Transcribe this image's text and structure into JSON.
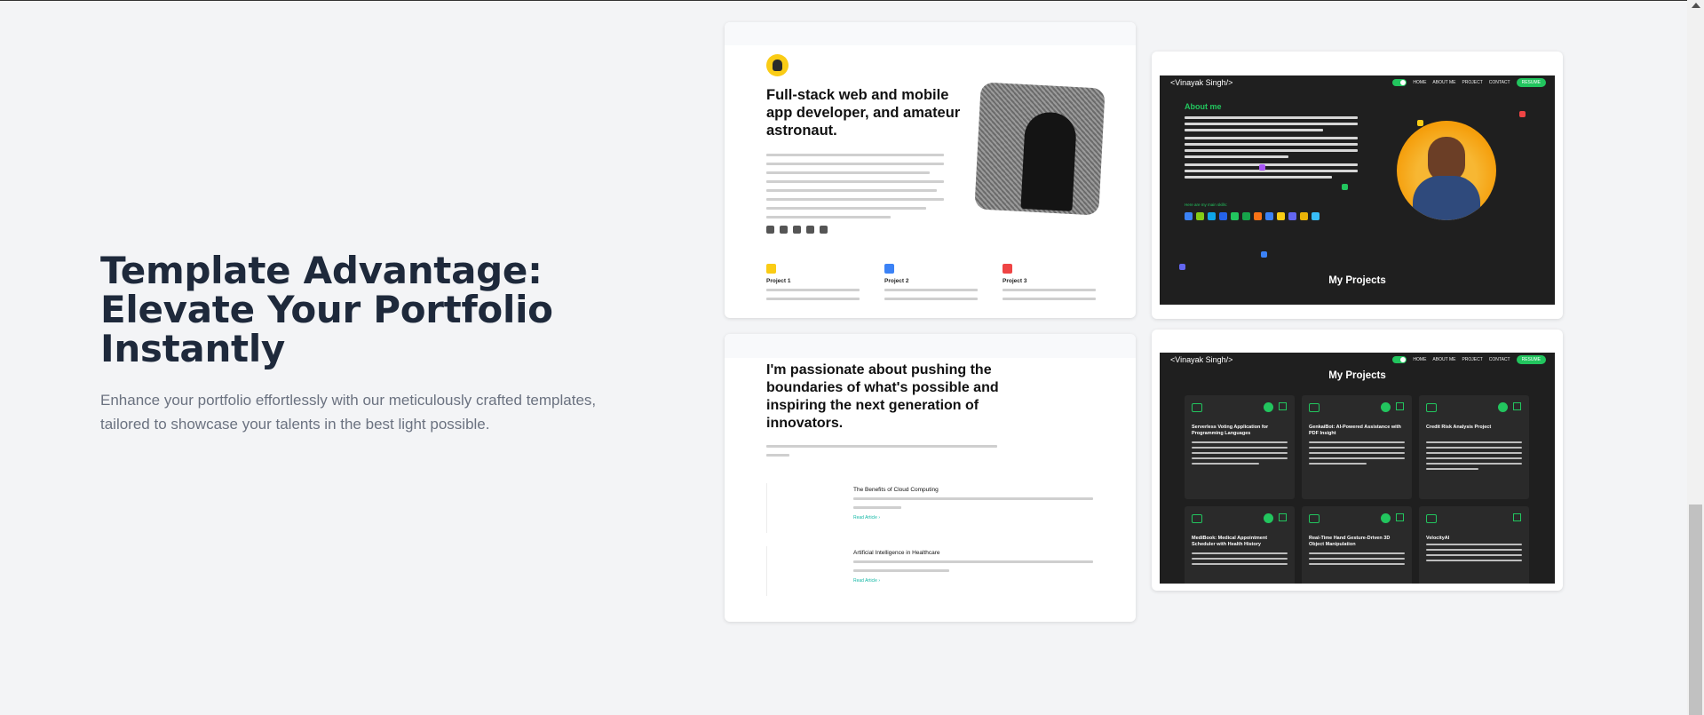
{
  "hero": {
    "title": "Template Advantage: Elevate Your Portfolio Instantly",
    "description": "Enhance your portfolio effortlessly with our meticulously crafted templates, tailored to showcase your talents in the best light possible."
  },
  "template1": {
    "headline": "Full-stack web and mobile app developer, and amateur astronaut.",
    "projects": [
      {
        "label": "Project 1",
        "icon_color": "#facc15"
      },
      {
        "label": "Project 2",
        "icon_color": "#3b82f6"
      },
      {
        "label": "Project 3",
        "icon_color": "#ef4444"
      }
    ]
  },
  "template2": {
    "brand": "<Vinayak Singh/>",
    "nav": [
      "HOME",
      "ABOUT ME",
      "PROJECT",
      "CONTACT"
    ],
    "resume_label": "RESUME",
    "about_title": "About me",
    "skills_label": "Here are my main skills:",
    "section_title": "My Projects",
    "accent": "#22c55e"
  },
  "template3": {
    "headline": "I'm passionate about pushing the boundaries of what's possible and inspiring the next generation of innovators.",
    "articles": [
      {
        "title": "The Benefits of Cloud Computing",
        "read_more": "Read Article ›"
      },
      {
        "title": "Artificial Intelligence in Healthcare",
        "read_more": "Read Article ›"
      }
    ]
  },
  "template4": {
    "brand": "<Vinayak Singh/>",
    "nav": [
      "HOME",
      "ABOUT ME",
      "PROJECT",
      "CONTACT"
    ],
    "resume_label": "RESUME",
    "section_title": "My Projects",
    "projects": [
      {
        "title": "Serverless Voting Application for Programming Languages"
      },
      {
        "title": "GenkaiBot: AI-Powered Assistance with PDF Insight"
      },
      {
        "title": "Credit Risk Analysis Project"
      },
      {
        "title": "MediBook: Medical Appointment Scheduler with Health History"
      },
      {
        "title": "Real-Time Hand Gesture-Driven 3D Object Manipulation"
      },
      {
        "title": "VelocityAI"
      }
    ]
  }
}
